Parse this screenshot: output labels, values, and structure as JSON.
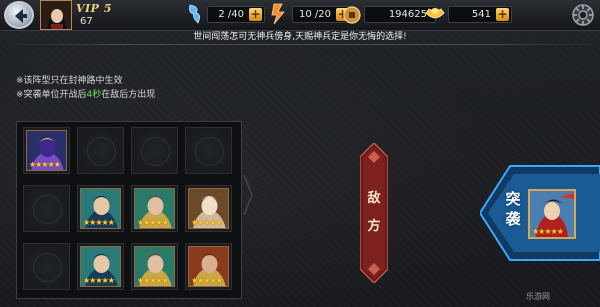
{
  "header": {
    "vip": "VIP 5",
    "level": "67",
    "stamina": "2 /40",
    "energy": "10 /20",
    "coins": "194625",
    "gold": "541"
  },
  "notice": "世间闯荡怎可无神兵傍身,天赐神兵定是你无悔的选择!",
  "tips": {
    "line1": "※该阵型只在封神路中生效",
    "line2_prefix": "※突袭单位开战后",
    "line2_highlight": "4秒",
    "line2_suffix": "在敌后方出现"
  },
  "formation": {
    "rows": [
      [
        "demon",
        "empty",
        "empty",
        "empty"
      ],
      [
        "empty",
        "general",
        "warrior",
        "priestess"
      ],
      [
        "empty",
        "general",
        "warrior",
        "bearded"
      ]
    ],
    "stars": "★★★★★"
  },
  "enemy_banner": {
    "char1": "敌",
    "char2": "方"
  },
  "raid": {
    "char1": "突",
    "char2": "袭"
  },
  "watermark": "乐游网"
}
